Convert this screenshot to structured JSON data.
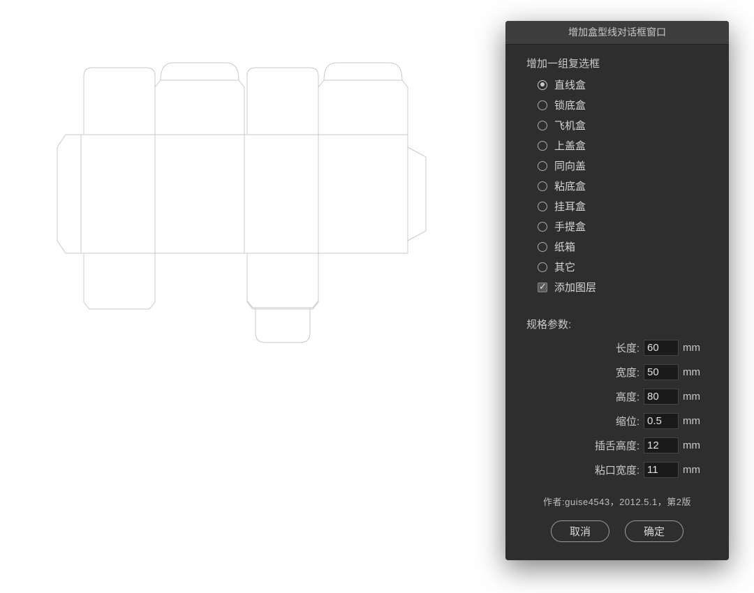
{
  "dialog": {
    "title": "增加盒型线对话框窗口",
    "group_label": "增加一组复选框",
    "options": [
      {
        "label": "直线盒",
        "checked": true
      },
      {
        "label": "锁底盒",
        "checked": false
      },
      {
        "label": "飞机盒",
        "checked": false
      },
      {
        "label": "上盖盒",
        "checked": false
      },
      {
        "label": "同向盖",
        "checked": false
      },
      {
        "label": "粘底盒",
        "checked": false
      },
      {
        "label": "挂耳盒",
        "checked": false
      },
      {
        "label": "手提盒",
        "checked": false
      },
      {
        "label": "纸箱",
        "checked": false
      },
      {
        "label": "其它",
        "checked": false
      }
    ],
    "add_layer_label": "添加图层",
    "add_layer_checked": true,
    "params_label": "规格参数:",
    "params": [
      {
        "label": "长度:",
        "value": "60",
        "unit": "mm"
      },
      {
        "label": "宽度:",
        "value": "50",
        "unit": "mm"
      },
      {
        "label": "高度:",
        "value": "80",
        "unit": "mm"
      },
      {
        "label": "缩位:",
        "value": "0.5",
        "unit": "mm"
      },
      {
        "label": "插舌高度:",
        "value": "12",
        "unit": "mm"
      },
      {
        "label": "粘口宽度:",
        "value": "11",
        "unit": "mm"
      }
    ],
    "footer": "作者:guise4543，2012.5.1，第2版",
    "cancel_label": "取消",
    "ok_label": "确定"
  }
}
